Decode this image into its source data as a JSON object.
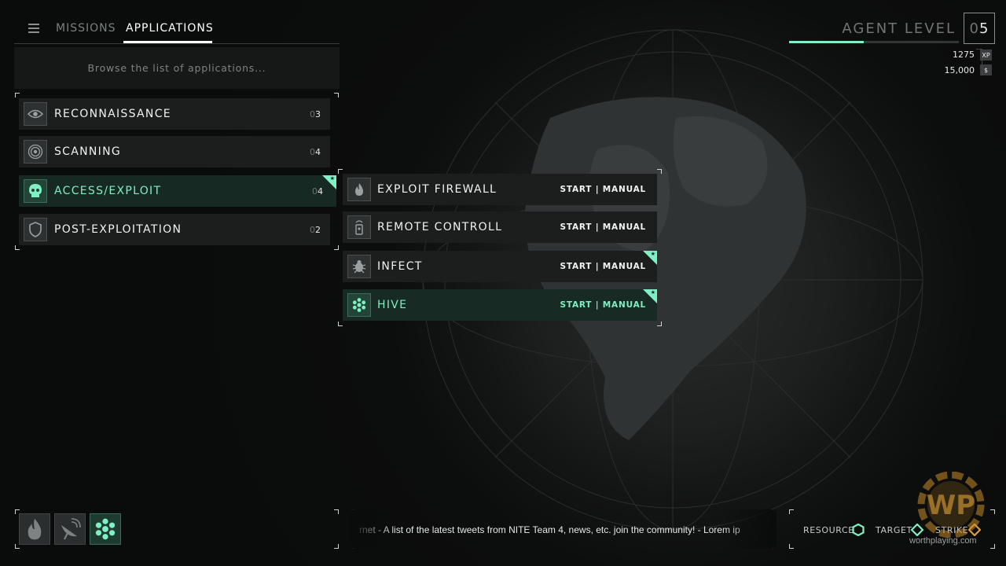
{
  "nav": {
    "tabs": [
      {
        "label": "MISSIONS",
        "active": false
      },
      {
        "label": "APPLICATIONS",
        "active": true
      }
    ]
  },
  "search": {
    "placeholder": "Browse the list of applications..."
  },
  "categories": [
    {
      "label": "RECONNAISSANCE",
      "count_dim": "0",
      "count": "3",
      "icon": "eye-icon",
      "active": false
    },
    {
      "label": "SCANNING",
      "count_dim": "0",
      "count": "4",
      "icon": "radar-icon",
      "active": false
    },
    {
      "label": "ACCESS/EXPLOIT",
      "count_dim": "0",
      "count": "4",
      "icon": "skull-icon",
      "active": true,
      "flagged": true
    },
    {
      "label": "POST-EXPLOITATION",
      "count_dim": "0",
      "count": "2",
      "icon": "shield-icon",
      "active": false
    }
  ],
  "applications": [
    {
      "label": "EXPLOIT FIREWALL",
      "action": "START | MANUAL",
      "icon": "flame-icon",
      "active": false,
      "flagged": false
    },
    {
      "label": "REMOTE CONTROLL",
      "action": "START | MANUAL",
      "icon": "remote-icon",
      "active": false,
      "flagged": false
    },
    {
      "label": "INFECT",
      "action": "START | MANUAL",
      "icon": "bug-icon",
      "active": false,
      "flagged": true
    },
    {
      "label": "HIVE",
      "action": "START | MANUAL",
      "icon": "hive-icon",
      "active": true,
      "flagged": true
    }
  ],
  "agent": {
    "label": "AGENT LEVEL",
    "level_dim": "0",
    "level": "5",
    "xp_progress": 0.44,
    "xp_value": "1275",
    "xp_unit": "XP",
    "money_value": "15,000",
    "money_unit": "$"
  },
  "quickbar": [
    {
      "icon": "flame-icon",
      "active": false
    },
    {
      "icon": "satellite-dish-icon",
      "active": false
    },
    {
      "icon": "hive-icon",
      "active": true
    }
  ],
  "ticker": {
    "text": "rnet - A list of the latest tweets from NITE Team 4, news, etc. join the community! - Lorem ip"
  },
  "legend": {
    "resource": "RESOURCE",
    "target": "TARGET",
    "strike": "STRIKE"
  },
  "watermark": {
    "logo": "WP",
    "text": "worthplaying.com"
  },
  "colors": {
    "accent": "#7ff0c4",
    "strike": "#e09a3a",
    "background": "#0a0b0b"
  }
}
